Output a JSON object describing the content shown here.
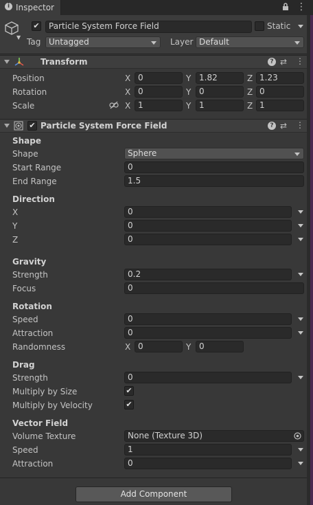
{
  "tab": {
    "label": "Inspector",
    "lock_icon": "lock-icon",
    "menu_icon": "kebab-menu-icon"
  },
  "object": {
    "name": "Particle System Force Field",
    "static_label": "Static",
    "tag_label": "Tag",
    "tag_value": "Untagged",
    "layer_label": "Layer",
    "layer_value": "Default"
  },
  "transform": {
    "title": "Transform",
    "position_label": "Position",
    "rotation_label": "Rotation",
    "scale_label": "Scale",
    "axis_x": "X",
    "axis_y": "Y",
    "axis_z": "Z",
    "position": {
      "x": "0",
      "y": "1.82",
      "z": "1.23"
    },
    "rotation": {
      "x": "0",
      "y": "0",
      "z": "0"
    },
    "scale": {
      "x": "1",
      "y": "1",
      "z": "1"
    }
  },
  "forcefield": {
    "title": "Particle System Force Field",
    "shape_section": "Shape",
    "shape_label": "Shape",
    "shape_value": "Sphere",
    "start_range_label": "Start Range",
    "start_range": "0",
    "end_range_label": "End Range",
    "end_range": "1.5",
    "direction_section": "Direction",
    "dir_x_label": "X",
    "dir_x": "0",
    "dir_y_label": "Y",
    "dir_y": "0",
    "dir_z_label": "Z",
    "dir_z": "0",
    "gravity_section": "Gravity",
    "gravity_strength_label": "Strength",
    "gravity_strength": "0.2",
    "gravity_focus_label": "Focus",
    "gravity_focus": "0",
    "rotation_section": "Rotation",
    "rot_speed_label": "Speed",
    "rot_speed": "0",
    "rot_attraction_label": "Attraction",
    "rot_attraction": "0",
    "rot_randomness_label": "Randomness",
    "rand_x_label": "X",
    "rand_x": "0",
    "rand_y_label": "Y",
    "rand_y": "0",
    "drag_section": "Drag",
    "drag_strength_label": "Strength",
    "drag_strength": "0",
    "multiply_size_label": "Multiply by Size",
    "multiply_size": true,
    "multiply_velocity_label": "Multiply by Velocity",
    "multiply_velocity": true,
    "vector_section": "Vector Field",
    "volume_texture_label": "Volume Texture",
    "volume_texture": "None (Texture 3D)",
    "vf_speed_label": "Speed",
    "vf_speed": "1",
    "vf_attraction_label": "Attraction",
    "vf_attraction": "0"
  },
  "add_component": "Add Component",
  "colors": {
    "panel_bg": "#383838",
    "header_bg": "#3e3e3e",
    "field_bg": "#2a2a2a",
    "accent_side": "#4a2950"
  }
}
